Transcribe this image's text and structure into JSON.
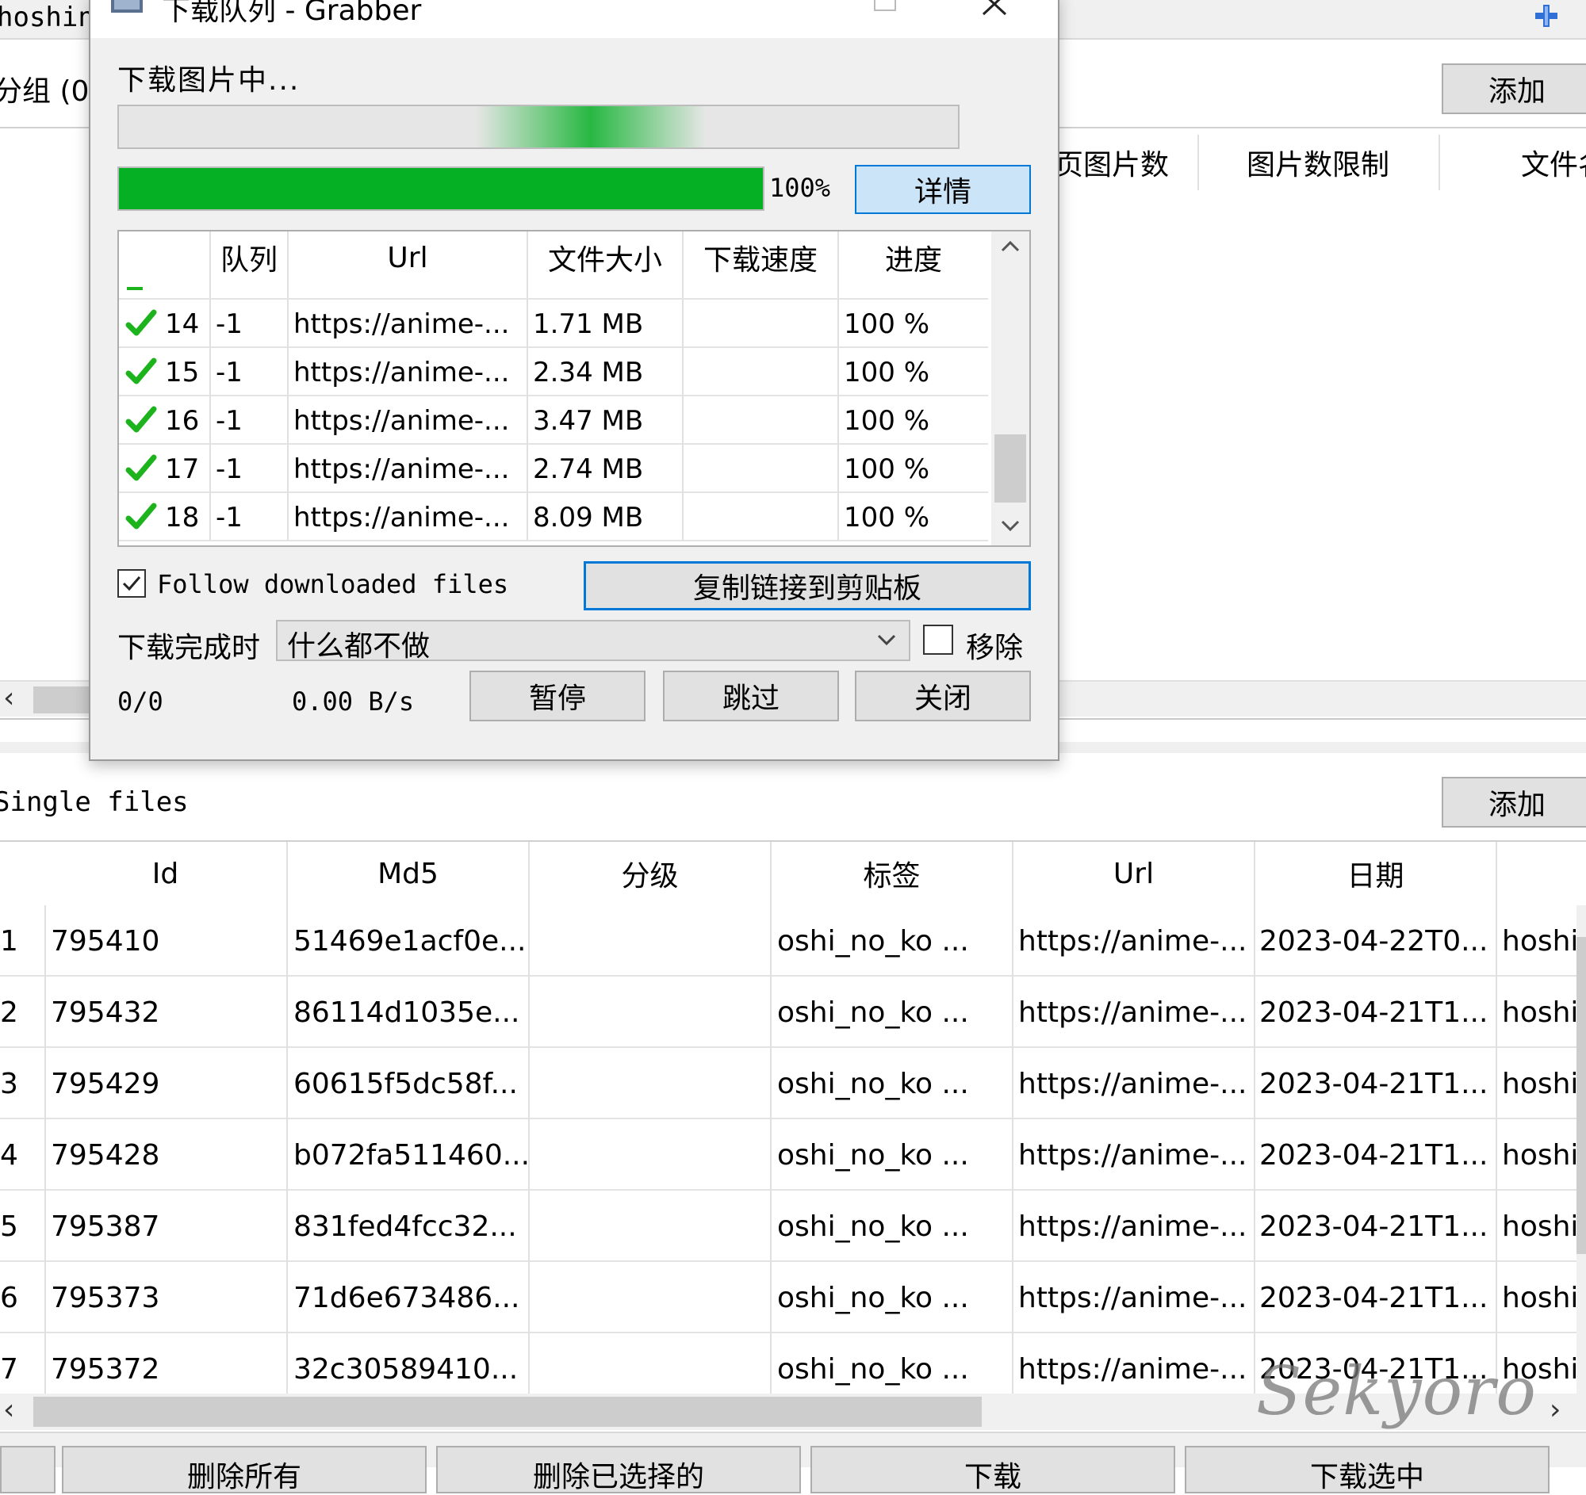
{
  "main": {
    "title_fragment": "hoshin",
    "group_label": "分组 (0",
    "add_button": "添加",
    "columns_top": [
      "页图片数",
      "图片数限制",
      "文件名"
    ],
    "single_files_label": "Single files",
    "add_button_2": "添加",
    "table": {
      "headers": [
        "Id",
        "Md5",
        "分级",
        "标签",
        "Url",
        "日期",
        ""
      ],
      "rows": [
        {
          "num": "1",
          "id": "795410",
          "md5": "51469e1acf0e...",
          "rating": "",
          "tags": "oshi_no_ko ...",
          "url": "https://anime-...",
          "date": "2023-04-22T0...",
          "extra": "hoshi"
        },
        {
          "num": "2",
          "id": "795432",
          "md5": "86114d1035e...",
          "rating": "",
          "tags": "oshi_no_ko ...",
          "url": "https://anime-...",
          "date": "2023-04-21T1...",
          "extra": "hoshi"
        },
        {
          "num": "3",
          "id": "795429",
          "md5": "60615f5dc58f...",
          "rating": "",
          "tags": "oshi_no_ko ...",
          "url": "https://anime-...",
          "date": "2023-04-21T1...",
          "extra": "hoshi"
        },
        {
          "num": "4",
          "id": "795428",
          "md5": "b072fa511460...",
          "rating": "",
          "tags": "oshi_no_ko ...",
          "url": "https://anime-...",
          "date": "2023-04-21T1...",
          "extra": "hoshi"
        },
        {
          "num": "5",
          "id": "795387",
          "md5": "831fed4fcc32...",
          "rating": "",
          "tags": "oshi_no_ko ...",
          "url": "https://anime-...",
          "date": "2023-04-21T1...",
          "extra": "hoshi"
        },
        {
          "num": "6",
          "id": "795373",
          "md5": "71d6e673486...",
          "rating": "",
          "tags": "oshi_no_ko ...",
          "url": "https://anime-...",
          "date": "2023-04-21T1...",
          "extra": "hoshi"
        },
        {
          "num": "7",
          "id": "795372",
          "md5": "32c30589410...",
          "rating": "",
          "tags": "oshi_no_ko ...",
          "url": "https://anime-...",
          "date": "2023-04-21T1...",
          "extra": "hoshi"
        }
      ]
    },
    "bottom_buttons": [
      "删除所有",
      "删除已选择的",
      "下载",
      "下载选中"
    ],
    "watermark": "Sekyoro"
  },
  "dialog": {
    "title": "下载队列 - Grabber",
    "status_text": "下载图片中...",
    "progress_percent_label": "100%",
    "progress_value": 1.0,
    "details_button": "详情",
    "queue_headers": [
      "",
      "队列",
      "Url",
      "文件大小",
      "下载速度",
      "进度"
    ],
    "queue_rows": [
      {
        "num": "14",
        "queue": "-1",
        "url": "https://anime-...",
        "size": "1.71 MB",
        "speed": "",
        "progress": "100 %"
      },
      {
        "num": "15",
        "queue": "-1",
        "url": "https://anime-...",
        "size": "2.34 MB",
        "speed": "",
        "progress": "100 %"
      },
      {
        "num": "16",
        "queue": "-1",
        "url": "https://anime-...",
        "size": "3.47 MB",
        "speed": "",
        "progress": "100 %"
      },
      {
        "num": "17",
        "queue": "-1",
        "url": "https://anime-...",
        "size": "2.74 MB",
        "speed": "",
        "progress": "100 %"
      },
      {
        "num": "18",
        "queue": "-1",
        "url": "https://anime-...",
        "size": "8.09 MB",
        "speed": "",
        "progress": "100 %"
      }
    ],
    "follow_label": "Follow downloaded files",
    "follow_checked": true,
    "copy_button": "复制链接到剪贴板",
    "on_complete_label": "下载完成时",
    "on_complete_value": "什么都不做",
    "remove_label": "移除",
    "remove_checked": false,
    "count_text": "0/0",
    "speed_text": "0.00 B/s",
    "pause_button": "暂停",
    "skip_button": "跳过",
    "close_button": "关闭"
  },
  "colors": {
    "progress_green": "#06b025",
    "check_green": "#1db31d",
    "accent_blue": "#0078d7"
  }
}
